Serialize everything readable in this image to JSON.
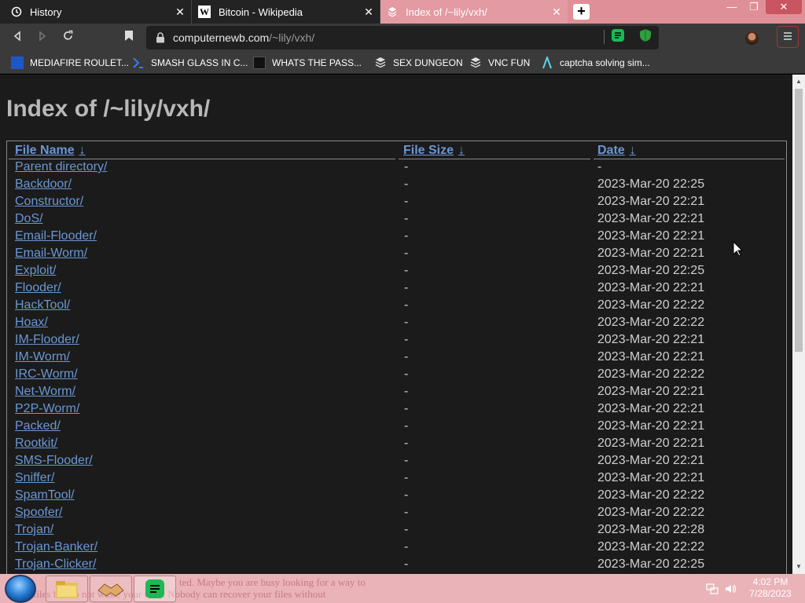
{
  "browser": {
    "tabs": [
      {
        "title": "History",
        "active": false
      },
      {
        "title": "Bitcoin - Wikipedia",
        "active": false
      },
      {
        "title": "Index of /~lily/vxh/",
        "active": true
      }
    ],
    "new_tab_label": "+",
    "window_controls": {
      "minimize": "—",
      "maximize": "❐",
      "close": "✕"
    },
    "url_host": "computernewb.com",
    "url_path": "/~lily/vxh/",
    "bookmarks": [
      "MEDIAFIRE ROULET...",
      "SMASH GLASS IN C...",
      "WHATS THE PASS...",
      "SEX DUNGEON",
      "VNC FUN",
      "captcha solving sim..."
    ],
    "colors": {
      "tabstrip": "#df8f97",
      "toolbar": "#3a3a3a",
      "link": "#6a97d4"
    }
  },
  "page": {
    "title": "Index of /~lily/vxh/",
    "headers": {
      "name": "File Name",
      "size": "File Size",
      "date": "Date",
      "sort_arrow": "↓"
    },
    "rows": [
      {
        "name": "Parent directory/",
        "size": "-",
        "date": "-"
      },
      {
        "name": "Backdoor/",
        "size": "-",
        "date": "2023-Mar-20 22:25"
      },
      {
        "name": "Constructor/",
        "size": "-",
        "date": "2023-Mar-20 22:21"
      },
      {
        "name": "DoS/",
        "size": "-",
        "date": "2023-Mar-20 22:21"
      },
      {
        "name": "Email-Flooder/",
        "size": "-",
        "date": "2023-Mar-20 22:21"
      },
      {
        "name": "Email-Worm/",
        "size": "-",
        "date": "2023-Mar-20 22:21"
      },
      {
        "name": "Exploit/",
        "size": "-",
        "date": "2023-Mar-20 22:25"
      },
      {
        "name": "Flooder/",
        "size": "-",
        "date": "2023-Mar-20 22:21"
      },
      {
        "name": "HackTool/",
        "size": "-",
        "date": "2023-Mar-20 22:22"
      },
      {
        "name": "Hoax/",
        "size": "-",
        "date": "2023-Mar-20 22:22"
      },
      {
        "name": "IM-Flooder/",
        "size": "-",
        "date": "2023-Mar-20 22:21"
      },
      {
        "name": "IM-Worm/",
        "size": "-",
        "date": "2023-Mar-20 22:21"
      },
      {
        "name": "IRC-Worm/",
        "size": "-",
        "date": "2023-Mar-20 22:22"
      },
      {
        "name": "Net-Worm/",
        "size": "-",
        "date": "2023-Mar-20 22:21"
      },
      {
        "name": "P2P-Worm/",
        "size": "-",
        "date": "2023-Mar-20 22:21"
      },
      {
        "name": "Packed/",
        "size": "-",
        "date": "2023-Mar-20 22:21"
      },
      {
        "name": "Rootkit/",
        "size": "-",
        "date": "2023-Mar-20 22:21"
      },
      {
        "name": "SMS-Flooder/",
        "size": "-",
        "date": "2023-Mar-20 22:21"
      },
      {
        "name": "Sniffer/",
        "size": "-",
        "date": "2023-Mar-20 22:21"
      },
      {
        "name": "SpamTool/",
        "size": "-",
        "date": "2023-Mar-20 22:22"
      },
      {
        "name": "Spoofer/",
        "size": "-",
        "date": "2023-Mar-20 22:22"
      },
      {
        "name": "Trojan/",
        "size": "-",
        "date": "2023-Mar-20 22:28"
      },
      {
        "name": "Trojan-Banker/",
        "size": "-",
        "date": "2023-Mar-20 22:22"
      },
      {
        "name": "Trojan-Clicker/",
        "size": "-",
        "date": "2023-Mar-20 22:25"
      }
    ]
  },
  "taskbar": {
    "ghost_text_line1": "ted. Maybe you are busy looking for a way to",
    "ghost_text_line2": "ur files but do not waste your time. Nobody can recover your files without",
    "clock_time": "4:02 PM",
    "clock_date": "7/28/2023"
  }
}
